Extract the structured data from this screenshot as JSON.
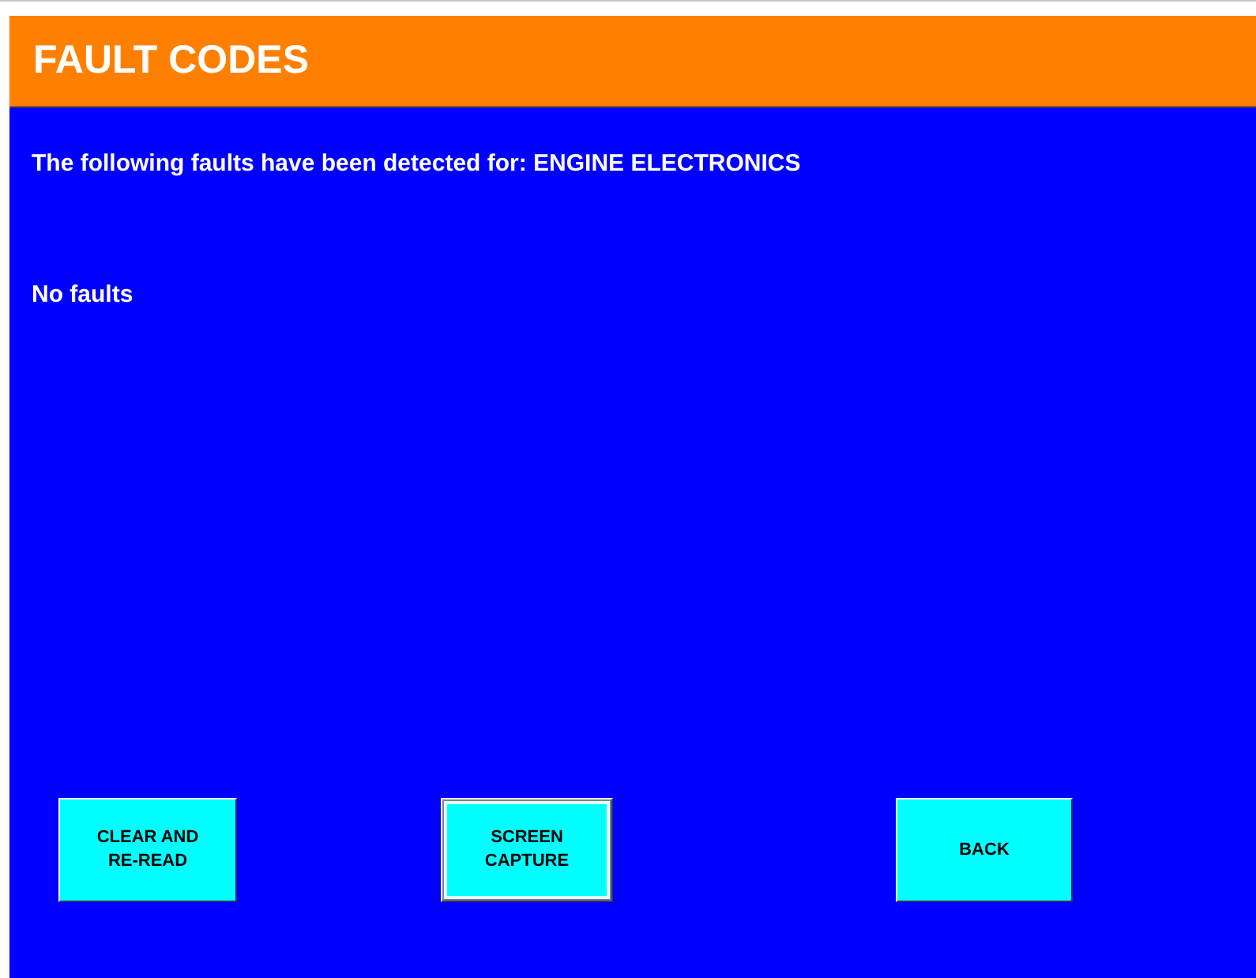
{
  "header": {
    "title": "FAULT CODES"
  },
  "message": "The following faults have been detected for: ENGINE ELECTRONICS",
  "result": "No faults",
  "buttons": [
    {
      "label": "CLEAR AND\nRE-READ",
      "focused": false
    },
    {
      "label": "SCREEN\nCAPTURE",
      "focused": true
    },
    {
      "label": "BACK",
      "focused": false
    }
  ]
}
